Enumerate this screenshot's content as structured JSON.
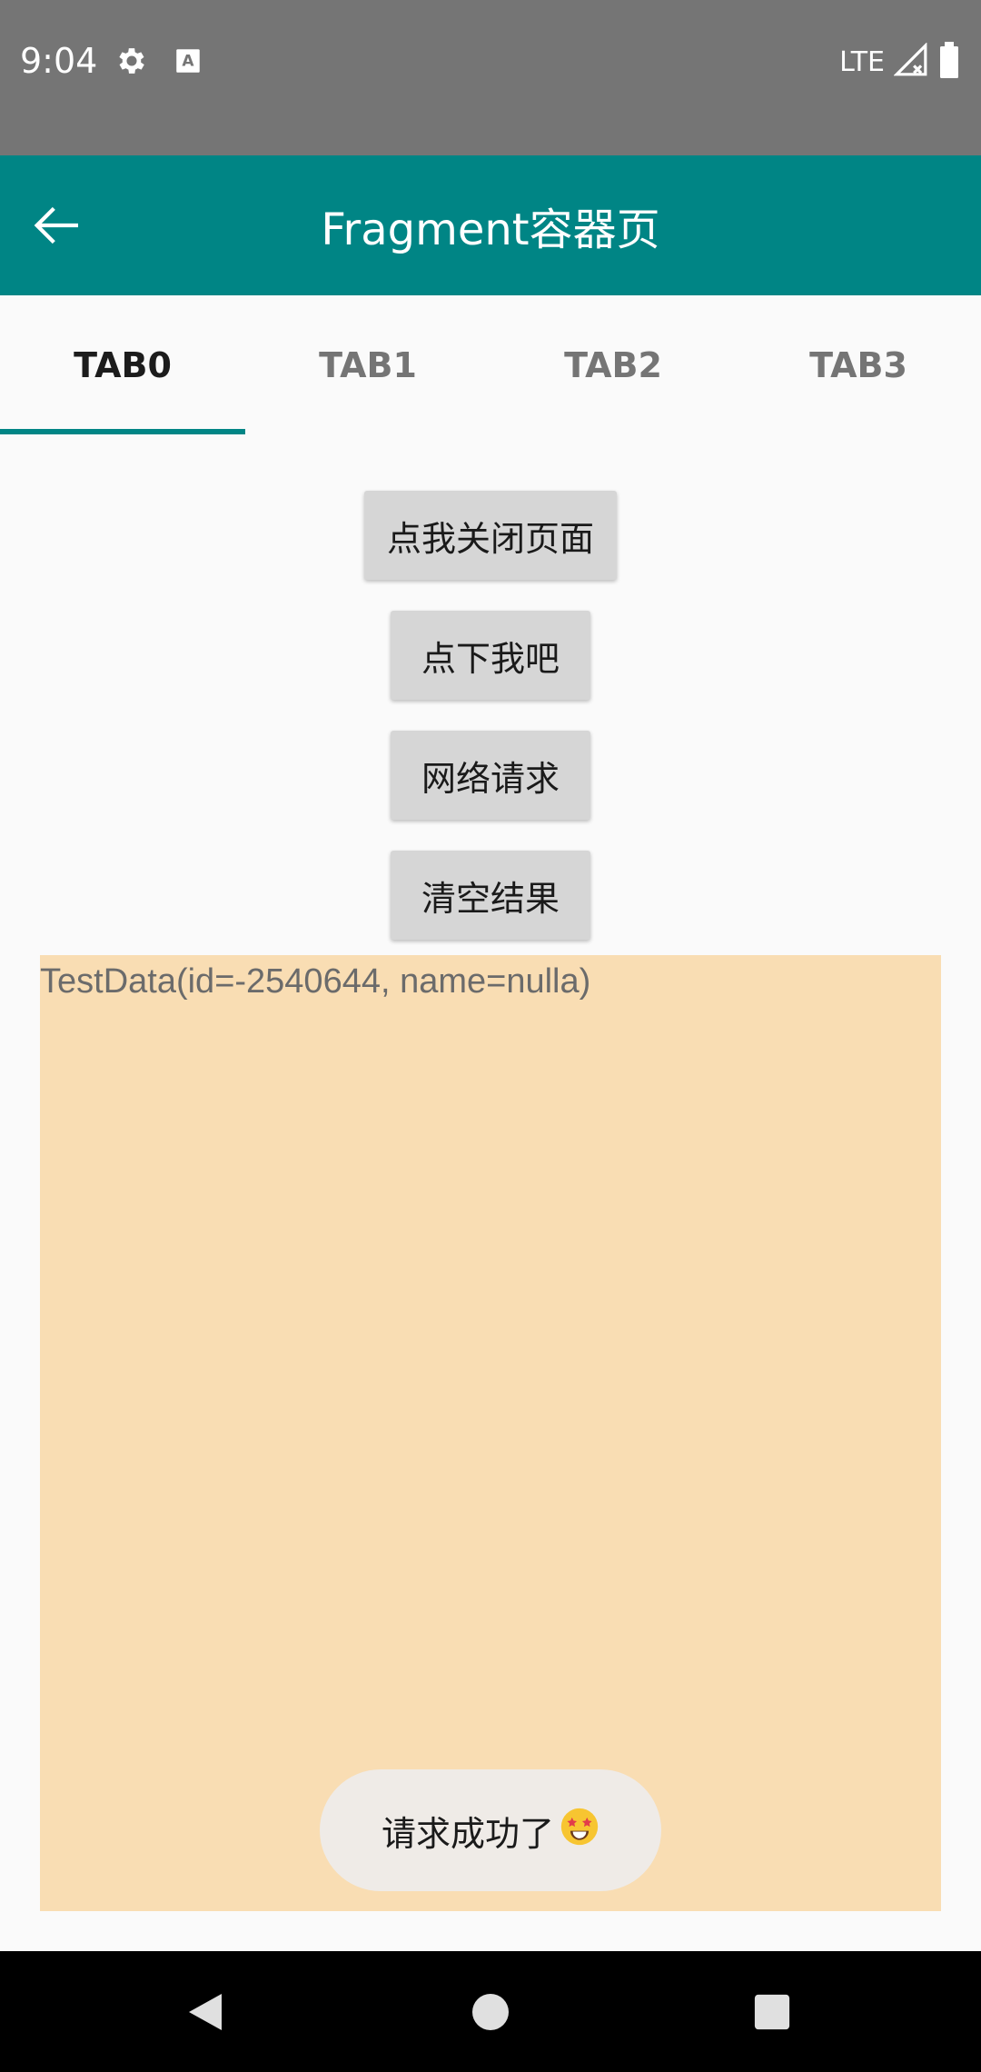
{
  "status_bar": {
    "time": "9:04",
    "network": "LTE",
    "icons": [
      "settings-gear-icon",
      "keyboard-a-icon",
      "signal-icon",
      "battery-icon"
    ]
  },
  "toolbar": {
    "title": "Fragment容器页",
    "back_icon": "back-arrow-icon"
  },
  "tabs": [
    {
      "label": "TAB0",
      "active": true
    },
    {
      "label": "TAB1",
      "active": false
    },
    {
      "label": "TAB2",
      "active": false
    },
    {
      "label": "TAB3",
      "active": false
    }
  ],
  "buttons": {
    "close_page": "点我关闭页面",
    "click_me": "点下我吧",
    "network_request": "网络请求",
    "clear_result": "清空结果"
  },
  "result": {
    "text": "TestData(id=-2540644, name=nulla)"
  },
  "toast": {
    "text": "请求成功了",
    "emoji_icon": "star-struck-emoji-icon"
  },
  "nav_bar": {
    "icons": [
      "back-triangle-icon",
      "home-circle-icon",
      "recents-square-icon"
    ]
  },
  "colors": {
    "primary": "#008585",
    "status_bar": "#757575",
    "result_bg": "#f9ddb3"
  }
}
